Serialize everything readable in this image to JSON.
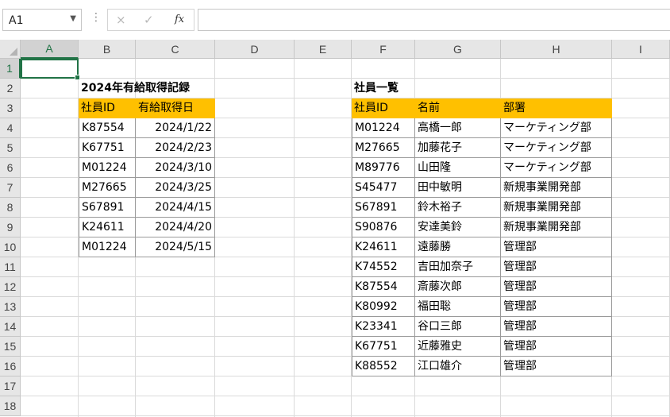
{
  "name_box": "A1",
  "formula_bar": {
    "cancel_icon": "×",
    "enter_icon": "✓",
    "function_label": "fx",
    "formula": ""
  },
  "columns": [
    "A",
    "B",
    "C",
    "D",
    "E",
    "F",
    "G",
    "H",
    "I"
  ],
  "rows": [
    "1",
    "2",
    "3",
    "4",
    "5",
    "6",
    "7",
    "8",
    "9",
    "10",
    "11",
    "12",
    "13",
    "14",
    "15",
    "16",
    "17",
    "18"
  ],
  "selected_cell": "A1",
  "colors": {
    "header_fill": "#ffc000",
    "selection": "#217346"
  },
  "leave_table": {
    "title": "2024年有給取得記録",
    "headers": [
      "社員ID",
      "有給取得日"
    ],
    "rows": [
      [
        "K87554",
        "2024/1/22"
      ],
      [
        "K67751",
        "2024/2/23"
      ],
      [
        "M01224",
        "2024/3/10"
      ],
      [
        "M27665",
        "2024/3/25"
      ],
      [
        "S67891",
        "2024/4/15"
      ],
      [
        "K24611",
        "2024/4/20"
      ],
      [
        "M01224",
        "2024/5/15"
      ]
    ]
  },
  "employee_table": {
    "title": "社員一覧",
    "headers": [
      "社員ID",
      "名前",
      "部署"
    ],
    "rows": [
      [
        "M01224",
        "高橋一郎",
        "マーケティング部"
      ],
      [
        "M27665",
        "加藤花子",
        "マーケティング部"
      ],
      [
        "M89776",
        "山田隆",
        "マーケティング部"
      ],
      [
        "S45477",
        "田中敏明",
        "新規事業開発部"
      ],
      [
        "S67891",
        "鈴木裕子",
        "新規事業開発部"
      ],
      [
        "S90876",
        "安達美鈴",
        "新規事業開発部"
      ],
      [
        "K24611",
        "遠藤勝",
        "管理部"
      ],
      [
        "K74552",
        "吉田加奈子",
        "管理部"
      ],
      [
        "K87554",
        "斎藤次郎",
        "管理部"
      ],
      [
        "K80992",
        "福田聡",
        "管理部"
      ],
      [
        "K23341",
        "谷口三郎",
        "管理部"
      ],
      [
        "K67751",
        "近藤雅史",
        "管理部"
      ],
      [
        "K88552",
        "江口雄介",
        "管理部"
      ]
    ]
  }
}
